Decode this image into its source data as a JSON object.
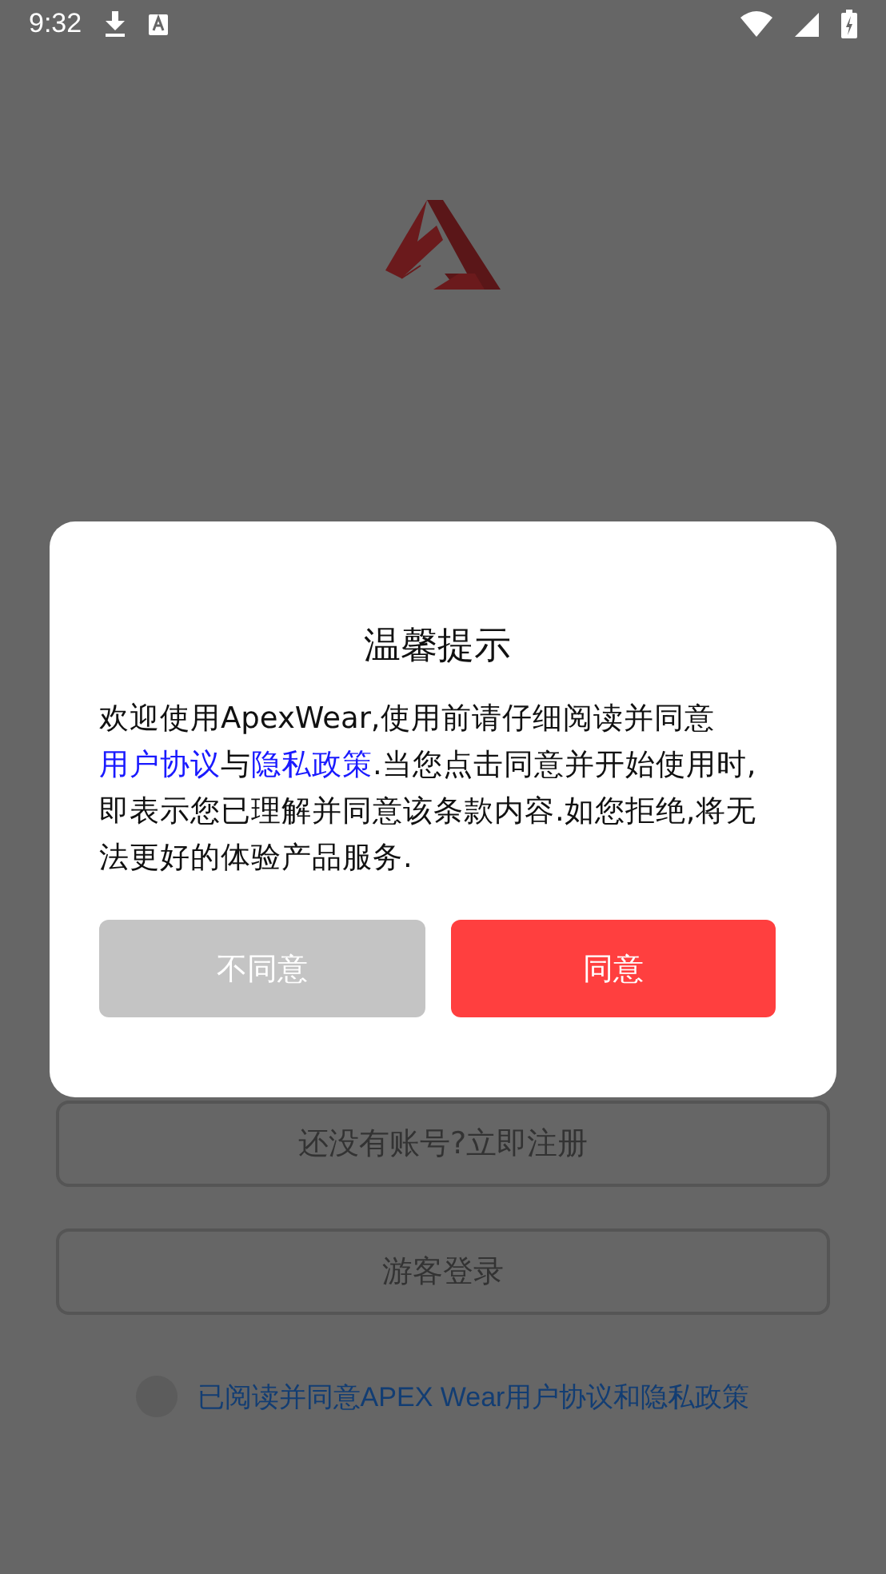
{
  "status_bar": {
    "time": "9:32"
  },
  "background": {
    "register_button": "还没有账号?立即注册",
    "guest_button": "游客登录",
    "agreement": {
      "checked": false,
      "label": "已阅读并同意APEX Wear用户协议和隐私政策"
    }
  },
  "dialog": {
    "title": "温馨提示",
    "body": [
      {
        "kind": "text",
        "text": "欢迎使用ApexWear,使用前请仔细阅读并同意"
      },
      {
        "kind": "link",
        "text": "用户协议"
      },
      {
        "kind": "text",
        "text": "与"
      },
      {
        "kind": "link",
        "text": "隐私政策"
      },
      {
        "kind": "text",
        "text": ".当您点击同意并开始使用时,即表示您已理解并同意该条款内容.如您拒绝,将无法更好的体验产品服务."
      }
    ],
    "buttons": [
      {
        "kind": "secondary",
        "label": "不同意"
      },
      {
        "kind": "primary",
        "label": "同意"
      }
    ]
  }
}
